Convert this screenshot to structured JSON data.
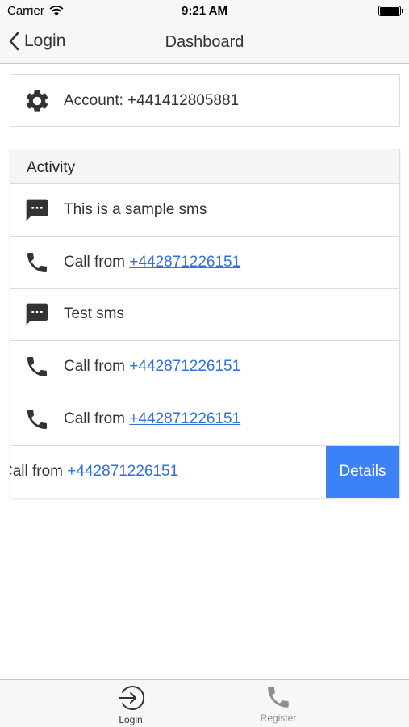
{
  "status": {
    "carrier": "Carrier",
    "time": "9:21 AM"
  },
  "nav": {
    "back_label": "Login",
    "title": "Dashboard"
  },
  "account": {
    "label": "Account: +441412805881"
  },
  "activity": {
    "header": "Activity",
    "rows": [
      {
        "type": "sms",
        "icon": "message-icon",
        "text": "This is a sample sms"
      },
      {
        "type": "call",
        "icon": "phone-icon",
        "prefix": "Call from ",
        "number": "+442871226151"
      },
      {
        "type": "sms",
        "icon": "message-icon",
        "text": "Test sms"
      },
      {
        "type": "call",
        "icon": "phone-icon",
        "prefix": "Call from ",
        "number": "+442871226151"
      },
      {
        "type": "call",
        "icon": "phone-icon",
        "prefix": "Call from ",
        "number": "+442871226151"
      },
      {
        "type": "call",
        "icon": "phone-icon",
        "prefix": "Call from ",
        "number": "+442871226151",
        "swiped": true,
        "action_label": "Details"
      }
    ]
  },
  "tabs": {
    "login_label": "Login",
    "register_label": "Register"
  },
  "colors": {
    "accent": "#3b82f6",
    "link": "#2f6fe0",
    "bar_background": "#f7f7f7"
  }
}
